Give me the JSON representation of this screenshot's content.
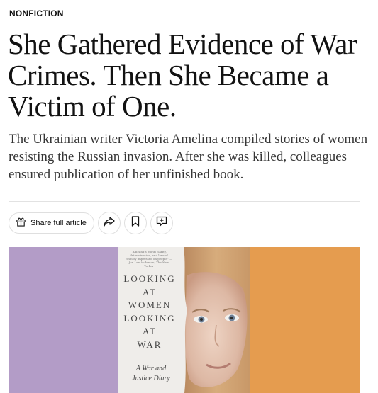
{
  "article": {
    "kicker": "NONFICTION",
    "headline": "She Gathered Evidence of War Crimes. Then She Became a Victim of One.",
    "summary": "The Ukrainian writer Victoria Amelina compiled stories of women resisting the Russian invasion. After she was killed, colleagues ensured publication of her unfinished book."
  },
  "share_bar": {
    "share_full_label": "Share full article",
    "icons": [
      "gift-icon",
      "share-arrow-icon",
      "bookmark-icon",
      "comment-icon"
    ]
  },
  "hero": {
    "left_color": "#b39cc7",
    "right_color": "#e59c4f",
    "cover": {
      "blurb": "“Amelina’s moral clarity, determination, and love of country impressed on people” —Jon Lee Anderson, The New Yorker",
      "title": "LOOKING\nAT\nWOMEN\nLOOKING\nAT\nWAR",
      "subtitle": "A War and\nJustice Diary"
    }
  }
}
